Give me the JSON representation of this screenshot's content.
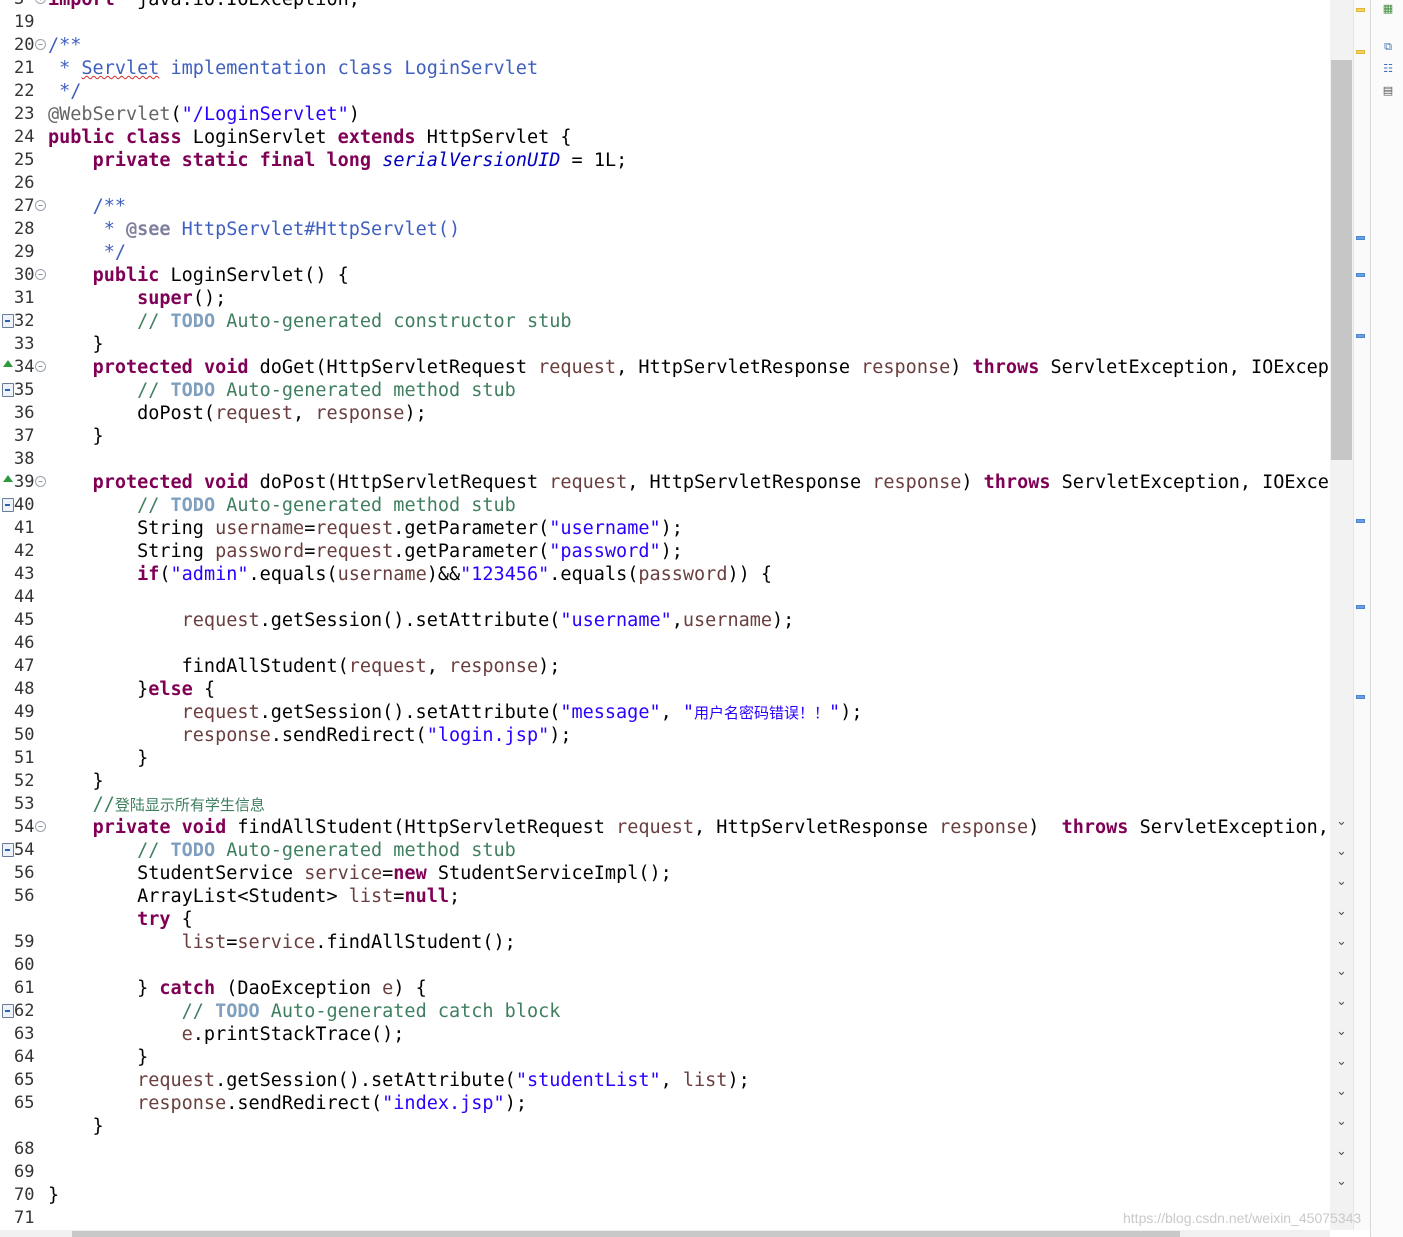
{
  "editor": {
    "lines": [
      {
        "num": "3",
        "fold": "plus",
        "marker": "none",
        "segs": [
          [
            "kw",
            "import"
          ],
          [
            "",
            "  java.io.IOException;"
          ]
        ]
      },
      {
        "num": "19",
        "fold": "",
        "marker": "none",
        "segs": []
      },
      {
        "num": "20",
        "fold": "minus",
        "marker": "none",
        "segs": [
          [
            "jdoc",
            "/**"
          ]
        ]
      },
      {
        "num": "21",
        "fold": "",
        "marker": "none",
        "segs": [
          [
            "jdoc",
            " * "
          ],
          [
            "jdoc squiggle",
            "Servlet"
          ],
          [
            "jdoc",
            " implementation class LoginServlet"
          ]
        ]
      },
      {
        "num": "22",
        "fold": "",
        "marker": "none",
        "segs": [
          [
            "jdoc",
            " */"
          ]
        ]
      },
      {
        "num": "23",
        "fold": "",
        "marker": "none",
        "segs": [
          [
            "ann",
            "@WebServlet"
          ],
          [
            "",
            "("
          ],
          [
            "str",
            "\"/LoginServlet\""
          ],
          [
            "",
            ")"
          ]
        ]
      },
      {
        "num": "24",
        "fold": "",
        "marker": "none",
        "segs": [
          [
            "kw",
            "public"
          ],
          [
            "",
            " "
          ],
          [
            "kw",
            "class"
          ],
          [
            "",
            " LoginServlet "
          ],
          [
            "kw",
            "extends"
          ],
          [
            "",
            " HttpServlet {"
          ]
        ]
      },
      {
        "num": "25",
        "fold": "",
        "marker": "none",
        "segs": [
          [
            "",
            "    "
          ],
          [
            "kw",
            "private"
          ],
          [
            "",
            " "
          ],
          [
            "kw",
            "static"
          ],
          [
            "",
            " "
          ],
          [
            "kw",
            "final"
          ],
          [
            "",
            " "
          ],
          [
            "kw",
            "long"
          ],
          [
            "",
            " "
          ],
          [
            "fld",
            "serialVersionUID"
          ],
          [
            "",
            " = 1L;"
          ]
        ]
      },
      {
        "num": "26",
        "fold": "",
        "marker": "none",
        "segs": []
      },
      {
        "num": "27",
        "fold": "minus",
        "marker": "none",
        "segs": [
          [
            "",
            "    "
          ],
          [
            "jdoc",
            "/**"
          ]
        ]
      },
      {
        "num": "28",
        "fold": "",
        "marker": "none",
        "segs": [
          [
            "",
            "     "
          ],
          [
            "jdoc",
            "* "
          ],
          [
            "tag",
            "@see"
          ],
          [
            "jdoc",
            " HttpServlet#HttpServlet()"
          ]
        ]
      },
      {
        "num": "29",
        "fold": "",
        "marker": "none",
        "segs": [
          [
            "",
            "     "
          ],
          [
            "jdoc",
            "*/"
          ]
        ]
      },
      {
        "num": "30",
        "fold": "minus",
        "marker": "none",
        "segs": [
          [
            "",
            "    "
          ],
          [
            "kw",
            "public"
          ],
          [
            "",
            " LoginServlet() {"
          ]
        ]
      },
      {
        "num": "31",
        "fold": "",
        "marker": "none",
        "segs": [
          [
            "",
            "        "
          ],
          [
            "kw",
            "super"
          ],
          [
            "",
            "();"
          ]
        ]
      },
      {
        "num": "32",
        "fold": "",
        "marker": "task",
        "segs": [
          [
            "",
            "        "
          ],
          [
            "cmt",
            "// "
          ],
          [
            "todo",
            "TODO"
          ],
          [
            "cmt",
            " Auto-generated constructor stub"
          ]
        ]
      },
      {
        "num": "33",
        "fold": "",
        "marker": "none",
        "segs": [
          [
            "",
            "    }"
          ]
        ]
      },
      {
        "num": "34",
        "fold": "minus",
        "marker": "override",
        "segs": [
          [
            "",
            "    "
          ],
          [
            "kw",
            "protected"
          ],
          [
            "",
            " "
          ],
          [
            "kw",
            "void"
          ],
          [
            "",
            " doGet(HttpServletRequest "
          ],
          [
            "var",
            "request"
          ],
          [
            "",
            ", HttpServletResponse "
          ],
          [
            "var",
            "response"
          ],
          [
            "",
            ") "
          ],
          [
            "kw",
            "throws"
          ],
          [
            "",
            " ServletException, IOExcepti"
          ]
        ]
      },
      {
        "num": "35",
        "fold": "",
        "marker": "task",
        "segs": [
          [
            "",
            "        "
          ],
          [
            "cmt",
            "// "
          ],
          [
            "todo",
            "TODO"
          ],
          [
            "cmt",
            " Auto-generated method stub"
          ]
        ]
      },
      {
        "num": "36",
        "fold": "",
        "marker": "none",
        "segs": [
          [
            "",
            "        doPost("
          ],
          [
            "var",
            "request"
          ],
          [
            "",
            ", "
          ],
          [
            "var",
            "response"
          ],
          [
            "",
            ");"
          ]
        ]
      },
      {
        "num": "37",
        "fold": "",
        "marker": "none",
        "segs": [
          [
            "",
            "    }"
          ]
        ]
      },
      {
        "num": "38",
        "fold": "",
        "marker": "none",
        "segs": []
      },
      {
        "num": "39",
        "fold": "minus",
        "marker": "override",
        "segs": [
          [
            "",
            "    "
          ],
          [
            "kw",
            "protected"
          ],
          [
            "",
            " "
          ],
          [
            "kw",
            "void"
          ],
          [
            "",
            " doPost(HttpServletRequest "
          ],
          [
            "var",
            "request"
          ],
          [
            "",
            ", HttpServletResponse "
          ],
          [
            "var",
            "response"
          ],
          [
            "",
            ") "
          ],
          [
            "kw",
            "throws"
          ],
          [
            "",
            " ServletException, IOExcept"
          ]
        ]
      },
      {
        "num": "40",
        "fold": "",
        "marker": "task",
        "segs": [
          [
            "",
            "        "
          ],
          [
            "cmt",
            "// "
          ],
          [
            "todo",
            "TODO"
          ],
          [
            "cmt",
            " Auto-generated method stub"
          ]
        ]
      },
      {
        "num": "41",
        "fold": "",
        "marker": "none",
        "segs": [
          [
            "",
            "        String "
          ],
          [
            "var",
            "username"
          ],
          [
            "",
            "="
          ],
          [
            "var",
            "request"
          ],
          [
            "",
            ".getParameter("
          ],
          [
            "str",
            "\"username\""
          ],
          [
            "",
            ");"
          ]
        ]
      },
      {
        "num": "42",
        "fold": "",
        "marker": "none",
        "segs": [
          [
            "",
            "        String "
          ],
          [
            "var",
            "password"
          ],
          [
            "",
            "="
          ],
          [
            "var",
            "request"
          ],
          [
            "",
            ".getParameter("
          ],
          [
            "str",
            "\"password\""
          ],
          [
            "",
            ");"
          ]
        ]
      },
      {
        "num": "43",
        "fold": "",
        "marker": "none",
        "segs": [
          [
            "",
            "        "
          ],
          [
            "kw",
            "if"
          ],
          [
            "",
            "("
          ],
          [
            "str",
            "\"admin\""
          ],
          [
            "",
            ".equals("
          ],
          [
            "var",
            "username"
          ],
          [
            "",
            ")&&"
          ],
          [
            "str",
            "\"123456\""
          ],
          [
            "",
            ".equals("
          ],
          [
            "var",
            "password"
          ],
          [
            "",
            ")) {"
          ]
        ]
      },
      {
        "num": "44",
        "fold": "",
        "marker": "none",
        "segs": []
      },
      {
        "num": "45",
        "fold": "",
        "marker": "none",
        "segs": [
          [
            "",
            "            "
          ],
          [
            "var",
            "request"
          ],
          [
            "",
            ".getSession().setAttribute("
          ],
          [
            "str",
            "\"username\""
          ],
          [
            "",
            ","
          ],
          [
            "var",
            "username"
          ],
          [
            "",
            ");"
          ]
        ]
      },
      {
        "num": "46",
        "fold": "",
        "marker": "none",
        "segs": []
      },
      {
        "num": "47",
        "fold": "",
        "marker": "none",
        "segs": [
          [
            "",
            "            findAllStudent("
          ],
          [
            "var",
            "request"
          ],
          [
            "",
            ", "
          ],
          [
            "var",
            "response"
          ],
          [
            "",
            ");"
          ]
        ]
      },
      {
        "num": "48",
        "fold": "",
        "marker": "none",
        "segs": [
          [
            "",
            "        }"
          ],
          [
            "kw",
            "else"
          ],
          [
            "",
            " {"
          ]
        ]
      },
      {
        "num": "49",
        "fold": "",
        "marker": "none",
        "segs": [
          [
            "",
            "            "
          ],
          [
            "var",
            "request"
          ],
          [
            "",
            ".getSession().setAttribute("
          ],
          [
            "str",
            "\"message\""
          ],
          [
            "",
            ", "
          ],
          [
            "str",
            "\""
          ],
          [
            "str cjk",
            "用户名密码错误！！"
          ],
          [
            "str",
            "\""
          ],
          [
            "",
            ");"
          ]
        ]
      },
      {
        "num": "50",
        "fold": "",
        "marker": "none",
        "segs": [
          [
            "",
            "            "
          ],
          [
            "var",
            "response"
          ],
          [
            "",
            ".sendRedirect("
          ],
          [
            "str",
            "\"login.jsp\""
          ],
          [
            "",
            ");"
          ]
        ]
      },
      {
        "num": "51",
        "fold": "",
        "marker": "none",
        "segs": [
          [
            "",
            "        }"
          ]
        ]
      },
      {
        "num": "52",
        "fold": "",
        "marker": "none",
        "segs": [
          [
            "",
            "    }"
          ]
        ]
      },
      {
        "num": "53",
        "fold": "",
        "marker": "none",
        "segs": [
          [
            "",
            "    "
          ],
          [
            "cmt",
            "//"
          ],
          [
            "cmt cjk",
            "登陆显示所有学生信息"
          ]
        ]
      },
      {
        "num": "54",
        "fold": "minus",
        "marker": "none",
        "segs": [
          [
            "",
            "    "
          ],
          [
            "kw",
            "private"
          ],
          [
            "",
            " "
          ],
          [
            "kw",
            "void"
          ],
          [
            "",
            " findAllStudent(HttpServletRequest "
          ],
          [
            "var",
            "request"
          ],
          [
            "",
            ", HttpServletResponse "
          ],
          [
            "var",
            "response"
          ],
          [
            "",
            ")  "
          ],
          [
            "kw",
            "throws"
          ],
          [
            "",
            " ServletException, I"
          ]
        ]
      },
      {
        "num": "54",
        "fold": "",
        "marker": "task",
        "segs": [
          [
            "",
            "        "
          ],
          [
            "cmt",
            "// "
          ],
          [
            "todo",
            "TODO"
          ],
          [
            "cmt",
            " Auto-generated method stub"
          ]
        ]
      },
      {
        "num": "56",
        "fold": "",
        "marker": "none",
        "segs": [
          [
            "",
            "        StudentService "
          ],
          [
            "var",
            "service"
          ],
          [
            "",
            "="
          ],
          [
            "kw",
            "new"
          ],
          [
            "",
            " StudentServiceImpl();"
          ]
        ]
      },
      {
        "num": "56",
        "fold": "",
        "marker": "none",
        "segs": [
          [
            "",
            "        ArrayList<Student> "
          ],
          [
            "var",
            "list"
          ],
          [
            "",
            "="
          ],
          [
            "kw",
            "null"
          ],
          [
            "",
            ";"
          ]
        ]
      },
      {
        "num": "",
        "fold": "",
        "marker": "none",
        "segs": [
          [
            "",
            "        "
          ],
          [
            "kw",
            "try"
          ],
          [
            "",
            " {"
          ]
        ]
      },
      {
        "num": "59",
        "fold": "",
        "marker": "none",
        "segs": [
          [
            "",
            "            "
          ],
          [
            "var",
            "list"
          ],
          [
            "",
            "="
          ],
          [
            "var",
            "service"
          ],
          [
            "",
            ".findAllStudent();"
          ]
        ]
      },
      {
        "num": "60",
        "fold": "",
        "marker": "none",
        "segs": []
      },
      {
        "num": "61",
        "fold": "",
        "marker": "none",
        "segs": [
          [
            "",
            "        } "
          ],
          [
            "kw",
            "catch"
          ],
          [
            "",
            " (DaoException "
          ],
          [
            "var",
            "e"
          ],
          [
            "",
            ") {"
          ]
        ]
      },
      {
        "num": "62",
        "fold": "",
        "marker": "task",
        "segs": [
          [
            "",
            "            "
          ],
          [
            "cmt",
            "// "
          ],
          [
            "todo",
            "TODO"
          ],
          [
            "cmt",
            " Auto-generated catch block"
          ]
        ]
      },
      {
        "num": "63",
        "fold": "",
        "marker": "none",
        "segs": [
          [
            "",
            "            "
          ],
          [
            "var",
            "e"
          ],
          [
            "",
            ".printStackTrace();"
          ]
        ]
      },
      {
        "num": "64",
        "fold": "",
        "marker": "none",
        "segs": [
          [
            "",
            "        }"
          ]
        ]
      },
      {
        "num": "65",
        "fold": "",
        "marker": "none",
        "segs": [
          [
            "",
            "        "
          ],
          [
            "var",
            "request"
          ],
          [
            "",
            ".getSession().setAttribute("
          ],
          [
            "str",
            "\"studentList\""
          ],
          [
            "",
            ", "
          ],
          [
            "var",
            "list"
          ],
          [
            "",
            ");"
          ]
        ]
      },
      {
        "num": "65",
        "fold": "",
        "marker": "none",
        "segs": [
          [
            "",
            "        "
          ],
          [
            "var",
            "response"
          ],
          [
            "",
            ".sendRedirect("
          ],
          [
            "str",
            "\"index.jsp\""
          ],
          [
            "",
            ");"
          ]
        ]
      },
      {
        "num": "",
        "fold": "",
        "marker": "none",
        "segs": [
          [
            "",
            "    }"
          ]
        ]
      },
      {
        "num": "68",
        "fold": "",
        "marker": "none",
        "segs": []
      },
      {
        "num": "69",
        "fold": "",
        "marker": "none",
        "segs": []
      },
      {
        "num": "70",
        "fold": "",
        "marker": "none",
        "segs": [
          [
            "",
            "}"
          ]
        ]
      },
      {
        "num": "71",
        "fold": "",
        "marker": "none",
        "segs": []
      }
    ]
  },
  "watermark": "https://blog.csdn.net/weixin_45075343",
  "colors": {
    "keyword": "#7f0055",
    "string": "#2a00ff",
    "comment": "#3f7f5f",
    "javadoc": "#3f5fbf",
    "field": "#0000c0"
  }
}
